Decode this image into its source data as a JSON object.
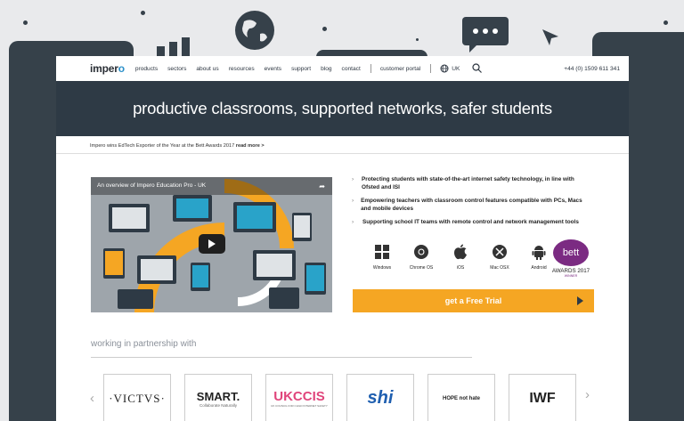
{
  "nav": {
    "logo_prefix": "imper",
    "logo_suffix": "o",
    "items": [
      "products",
      "sectors",
      "about us",
      "resources",
      "events",
      "support",
      "blog",
      "contact"
    ],
    "customer_portal": "customer portal",
    "region": "UK",
    "phone": "+44 (0) 1509 611 341"
  },
  "hero": {
    "headline": "productive classrooms, supported networks, safer students"
  },
  "news": {
    "text": "Impero wins EdTech Exporter of the Year at the Bett Awards 2017",
    "link": "read more >"
  },
  "video": {
    "title": "An overview of Impero Education Pro - UK"
  },
  "features": [
    "Protecting students with state-of-the-art internet safety technology, in line with Ofsted and ISI",
    "Empowering teachers with classroom control features compatible with PCs, Macs and mobile devices",
    "Supporting school IT teams with remote control and network management tools"
  ],
  "platforms": [
    "Windows",
    "Chrome OS",
    "iOS",
    "Mac OSX",
    "Android"
  ],
  "award": {
    "logo": "bett",
    "title": "AWARDS 2017",
    "sub": "WINNER"
  },
  "cta": {
    "label": "get a Free Trial"
  },
  "partners": {
    "heading": "working in partnership with",
    "logos": [
      {
        "name": "·VICTVS·"
      },
      {
        "name": "SMART.",
        "tag": "Collaborate Naturally"
      },
      {
        "name": "UKCCIS",
        "tag": "UK COUNCIL FOR CHILD INTERNET SAFETY"
      },
      {
        "name": "shi"
      },
      {
        "name": "HOPE not hate"
      },
      {
        "name": "IWF"
      }
    ]
  },
  "colors": {
    "navy": "#2e3a45",
    "orange": "#f5a623",
    "blue": "#2a8fc9",
    "purple": "#7b2b82"
  }
}
